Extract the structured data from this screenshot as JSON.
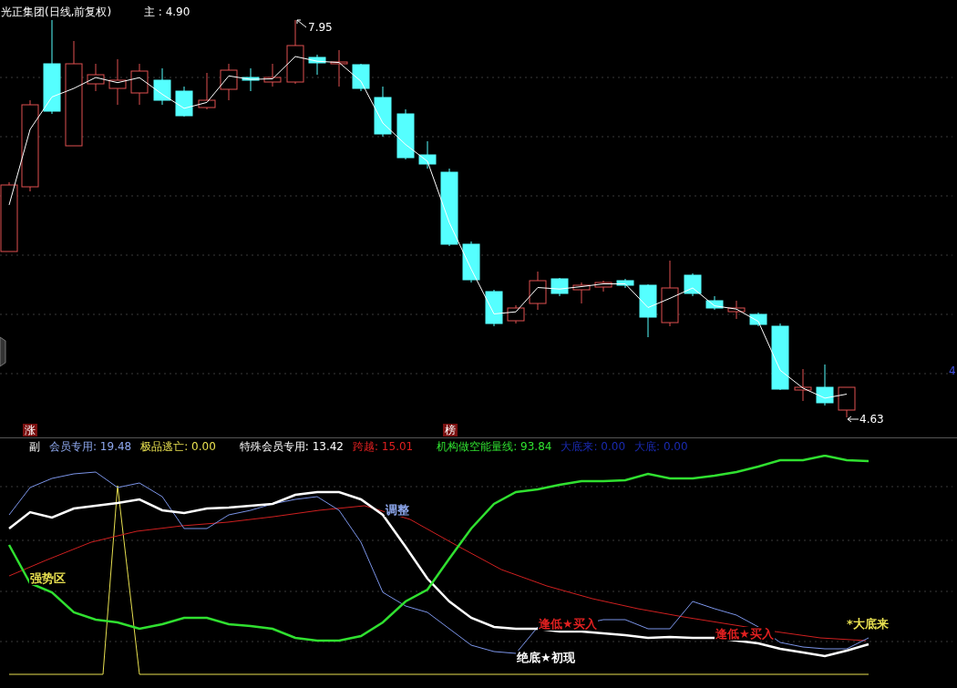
{
  "main_chart": {
    "title": "光正集团(日线,前复权)",
    "price_label": "主 : 4.90",
    "high_label": "7.95",
    "low_label": "4.63",
    "edge_label": "4",
    "tags": [
      "涨",
      "榜"
    ]
  },
  "indicator": {
    "label": "副",
    "legend": [
      {
        "text": "会员专用: 19.48",
        "color": "#8ea8ee"
      },
      {
        "text": "极品逃亡: 0.00",
        "color": "#e8e050"
      },
      {
        "text": "特殊会员专用: 13.42",
        "color": "#ffffff"
      },
      {
        "text": "跨越: 15.01",
        "color": "#e02020"
      },
      {
        "text": "机构做空能量线: 93.84",
        "color": "#30e030"
      },
      {
        "text": "大底来: 0.00",
        "color": "#1a2ab0"
      },
      {
        "text": "大底: 0.00",
        "color": "#1a2ab0"
      }
    ],
    "annotations": [
      {
        "text": "调整",
        "color": "#8ea8ee"
      },
      {
        "text": "强势区",
        "color": "#e8e050"
      },
      {
        "text": "逢低★买入",
        "color": "#e02020"
      },
      {
        "text": "逢低★买入",
        "color": "#e02020"
      },
      {
        "text": "绝底★初现",
        "color": "#ffffff"
      },
      {
        "text": "*大底来",
        "color": "#e8e050"
      }
    ]
  }
}
